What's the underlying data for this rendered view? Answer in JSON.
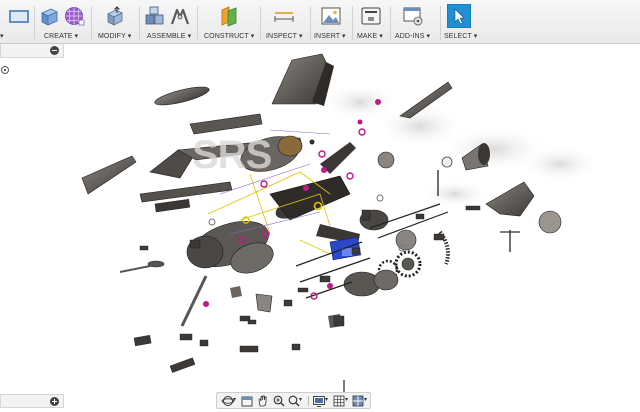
{
  "toolbar": {
    "groups": [
      {
        "label": "CREATE ▾"
      },
      {
        "label": "MODIFY ▾"
      },
      {
        "label": "ASSEMBLE ▾"
      },
      {
        "label": "CONSTRUCT ▾"
      },
      {
        "label": "INSPECT ▾"
      },
      {
        "label": "INSERT ▾"
      },
      {
        "label": "MAKE ▾"
      },
      {
        "label": "ADD-INS ▾"
      },
      {
        "label": "SELECT ▾"
      }
    ],
    "left_caret": "▾"
  },
  "viewport": {
    "watermark": "SRS"
  },
  "colors": {
    "accent_select": "#1f8fd6",
    "part_gray": "#5a5550",
    "joint_magenta": "#c0188a",
    "joint_yellow": "#e0c400"
  }
}
